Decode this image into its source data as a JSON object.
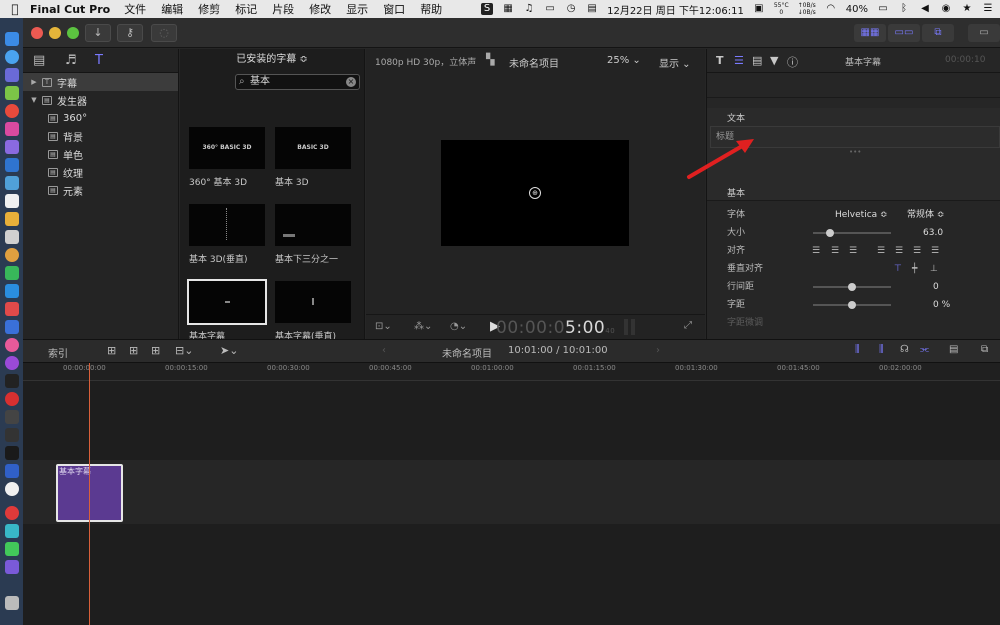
{
  "menubar": {
    "app": "Final Cut Pro",
    "items": [
      "文件",
      "编辑",
      "修剪",
      "标记",
      "片段",
      "修改",
      "显示",
      "窗口",
      "帮助"
    ],
    "temp": "55°C",
    "temp2": "0",
    "net_up": "0B/s",
    "net_down": "0B/s",
    "datetime": "12月22日 周日 下午12:06:11",
    "battery": "40%"
  },
  "sidebar": {
    "items": [
      {
        "label": "字幕",
        "level": 0,
        "selected": true
      },
      {
        "label": "发生器",
        "level": 0,
        "selected": false
      },
      {
        "label": "360°",
        "level": 1
      },
      {
        "label": "背景",
        "level": 1
      },
      {
        "label": "单色",
        "level": 1
      },
      {
        "label": "纹理",
        "level": 1
      },
      {
        "label": "元素",
        "level": 1
      }
    ]
  },
  "browser": {
    "header": "已安装的字幕 ≎",
    "search_value": "基本",
    "thumbs": [
      {
        "label": "360° 基本 3D",
        "art": "360° BASIC 3D"
      },
      {
        "label": "基本 3D",
        "art": "BASIC 3D"
      },
      {
        "label": "基本 3D(垂直)",
        "art": ""
      },
      {
        "label": "基本下三分之一",
        "art": ""
      },
      {
        "label": "基本字幕",
        "art": ""
      },
      {
        "label": "基本字幕(垂直)",
        "art": ""
      }
    ]
  },
  "viewer": {
    "format": "1080p HD 30p，立体声",
    "project": "未命名项目",
    "zoom": "25% ⌄",
    "display": "显示 ⌄",
    "timecode_dim": "00:00:0",
    "timecode_main": "5:00",
    "timecode_frames": "40"
  },
  "inspector": {
    "title": "基本字幕",
    "time": "00:00:10",
    "section_text": "文本",
    "title_field": "标题",
    "section_basic": "基本",
    "font_label": "字体",
    "font_value": "Helvetica ≎",
    "font_style": "常规体 ≎",
    "size_label": "大小",
    "size_value": "63.0",
    "size_fraction": 0.22,
    "align_label": "对齐",
    "valign_label": "垂直对齐",
    "line_spacing_label": "行间距",
    "line_spacing_value": "0",
    "line_spacing_fraction": 0.5,
    "tracking_label": "字距",
    "tracking_value": "0 %",
    "tracking_fraction": 0.5,
    "kerning_label": "字距微调"
  },
  "timeline": {
    "index": "索引",
    "project": "未命名项目",
    "duration": "10:01:00 / 10:01:00",
    "ticks": [
      "00:00:00:00",
      "00:00:15:00",
      "00:00:30:00",
      "00:00:45:00",
      "00:01:00:00",
      "00:01:15:00",
      "00:01:30:00",
      "00:01:45:00",
      "00:02:00:00"
    ],
    "clip_label": "基本字幕"
  },
  "colors": {
    "accent": "#7a7aff",
    "clip": "#5b3a91",
    "playhead": "#d9603a",
    "arrow": "#e02020"
  }
}
